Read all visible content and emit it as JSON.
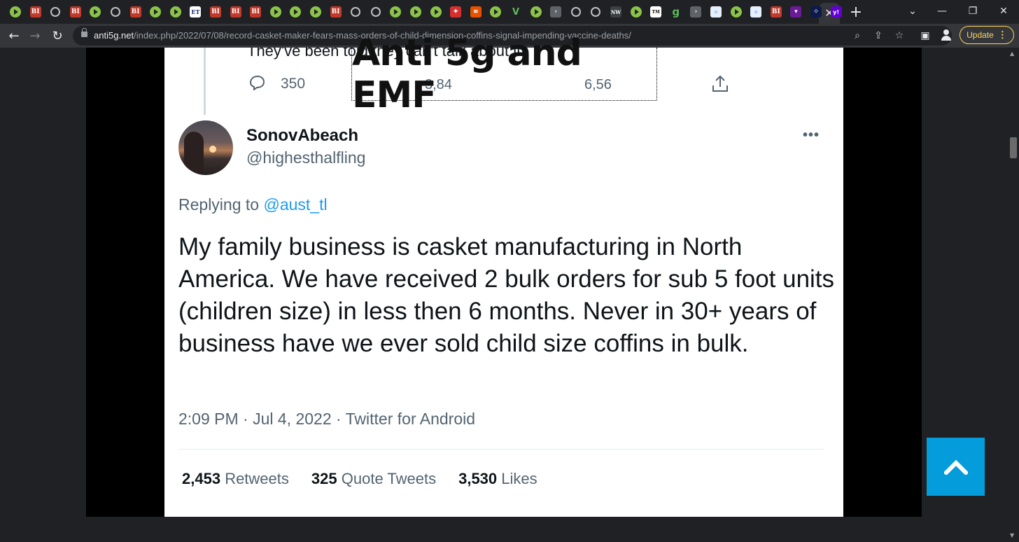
{
  "browser": {
    "tabs": [
      {
        "kind": "play"
      },
      {
        "kind": "bi",
        "text": "BI"
      },
      {
        "kind": "globe"
      },
      {
        "kind": "bi",
        "text": "BI"
      },
      {
        "kind": "play"
      },
      {
        "kind": "globe"
      },
      {
        "kind": "bi",
        "text": "BI"
      },
      {
        "kind": "play"
      },
      {
        "kind": "play"
      },
      {
        "kind": "et",
        "text": "ET"
      },
      {
        "kind": "bi",
        "text": "BI"
      },
      {
        "kind": "bi",
        "text": "BI"
      },
      {
        "kind": "bi",
        "text": "BI"
      },
      {
        "kind": "play"
      },
      {
        "kind": "play"
      },
      {
        "kind": "play"
      },
      {
        "kind": "bi",
        "text": "BI"
      },
      {
        "kind": "globe"
      },
      {
        "kind": "globe"
      },
      {
        "kind": "play"
      },
      {
        "kind": "play"
      },
      {
        "kind": "play"
      },
      {
        "kind": "red",
        "text": "✦"
      },
      {
        "kind": "orange",
        "text": "≡"
      },
      {
        "kind": "play"
      },
      {
        "kind": "v",
        "text": "V"
      },
      {
        "kind": "play"
      },
      {
        "kind": "gray",
        "text": "›"
      },
      {
        "kind": "globe"
      },
      {
        "kind": "globe"
      },
      {
        "kind": "dark",
        "text": "NW"
      },
      {
        "kind": "play"
      },
      {
        "kind": "blk",
        "text": "TM"
      },
      {
        "kind": "g",
        "text": "g"
      },
      {
        "kind": "gray",
        "text": "›"
      },
      {
        "kind": "chk",
        "text": "⁘"
      },
      {
        "kind": "play"
      },
      {
        "kind": "chk",
        "text": "⁘"
      },
      {
        "kind": "bi",
        "text": "BI"
      },
      {
        "kind": "purple",
        "text": "▾"
      },
      {
        "kind": "navy",
        "text": "⁘"
      },
      {
        "kind": "yahoo",
        "text": "y!"
      }
    ],
    "active_tab_close": "✕",
    "new_tab": "+",
    "window_controls": {
      "dropdown": "⌄",
      "minimize": "—",
      "restore": "❐",
      "close": "✕"
    },
    "url_host": "anti5g.net",
    "url_path": "/index.php/2022/07/08/record-casket-maker-fears-mass-orders-of-child-dimension-coffins-signal-impending-vaccine-deaths/",
    "update_label": "Update",
    "update_dots": "⋮"
  },
  "site": {
    "logo_text": "Anti 5g and EMF",
    "accent": "#049cdb"
  },
  "tweet": {
    "previous_text_fragment": "They've been told they can't talk about it.",
    "reply_count": "350",
    "retweet_count_partial": "3,84",
    "like_count_partial": "6,56",
    "display_name": "SonovAbeach",
    "handle": "@highesthalfling",
    "more_icon": "•••",
    "replying_prefix": "Replying to ",
    "replying_mention": "@aust_tl",
    "text": "My family business is casket manufacturing in North America. We have received 2 bulk orders for sub 5 foot units (children size) in less then 6 months. Never in 30+ years of business have we ever sold child size coffins in bulk.",
    "meta": "2:09 PM · Jul 4, 2022 · Twitter for Android",
    "stats": [
      {
        "count": "2,453",
        "label": "Retweets"
      },
      {
        "count": "325",
        "label": "Quote Tweets"
      },
      {
        "count": "3,530",
        "label": "Likes"
      }
    ]
  }
}
